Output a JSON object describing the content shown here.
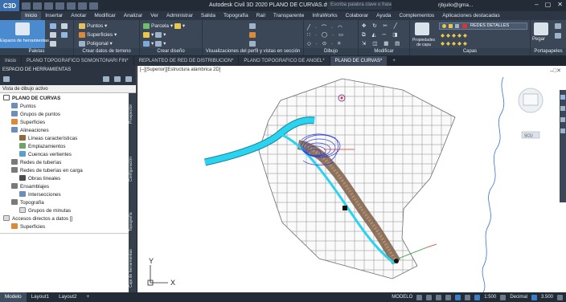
{
  "titlebar": {
    "logo": "C3D",
    "title": "Autodesk Civil 3D 2020   PLANO DE CURVAS.dwg",
    "search_placeholder": "Escriba palabra clave o frase",
    "user": "rjbjulio@gma...",
    "controls": [
      "–",
      "▢",
      "✕"
    ]
  },
  "ribbon_tabs": [
    "Inicio",
    "Insertar",
    "Anotar",
    "Modificar",
    "Analizar",
    "Ver",
    "Administrar",
    "Salida",
    "Topografía",
    "Rail",
    "Transparente",
    "InfraWorks",
    "Colaborar",
    "Ayuda",
    "Complementos",
    "Aplicaciones destacadas"
  ],
  "ribbon": {
    "paletas_title": "Paletas",
    "espacio_label": "Espacio de herramientas",
    "terreno_title": "Crear datos de terreno",
    "puntos": "Puntos",
    "superficies": "Superficies",
    "poligonal": "Poligonal",
    "diseno_title": "Crear diseño",
    "parcela": "Parcela",
    "perfil_title": "Visualizaciones del perfil y vistas en sección",
    "dibujo_title": "Dibujo",
    "modificar_title": "Modificar",
    "propiedades_label": "Propiedades de capa",
    "capa_name": "REDES DETALLES",
    "capas_title": "Capas",
    "pegar": "Pegar",
    "portapapeles_title": "Portapapeles"
  },
  "doc_tabs": [
    "Inicio",
    "PLANO TOPOGRAFICO SOMONTONARI FIN*",
    "REPLANTEO DE RED DE DISTRIBUCION*",
    "PLANO TOPOGRAFICO DE ANGEL*",
    "PLANO DE CURVAS*"
  ],
  "palette": {
    "header": "ESPACIO DE HERRAMIENTAS",
    "view_label": "Vista de dibujo activo",
    "side_tabs": [
      "Prospector",
      "Configuración",
      "Topografía",
      "Caja de herramientas"
    ],
    "tree": [
      "PLANO DE CURVAS",
      "Puntos",
      "Grupos de puntos",
      "Superficies",
      "Alineaciones",
      "Líneas características",
      "Emplazamientos",
      "Cuencas vertientes",
      "Redes de tuberías",
      "Redes de tuberías en carga",
      "Obras lineales",
      "Ensamblajes",
      "Intersecciones",
      "Topografía",
      "Grupos de minutas",
      "Accesos directos a datos []",
      "Superficies"
    ]
  },
  "canvas": {
    "viewport_label": "[–][Superior][Estructura alámbrica 2D]",
    "nav_controls": "–□✕",
    "viewcube_label": "SCU",
    "axis_y": "Y",
    "axis_x": "X"
  },
  "statusbar": {
    "tabs": [
      "Modelo",
      "Layout1",
      "Layout2",
      "+"
    ],
    "mode": "MODELO",
    "scale": "1:500",
    "units": "Decimal",
    "number": "3.500"
  },
  "colors": {
    "alignment": "#29d4f0",
    "terrain": "#7a5c45",
    "contours": "#2f3fd6",
    "grid": "#8a8a8a",
    "river": "#3b6fd8"
  }
}
